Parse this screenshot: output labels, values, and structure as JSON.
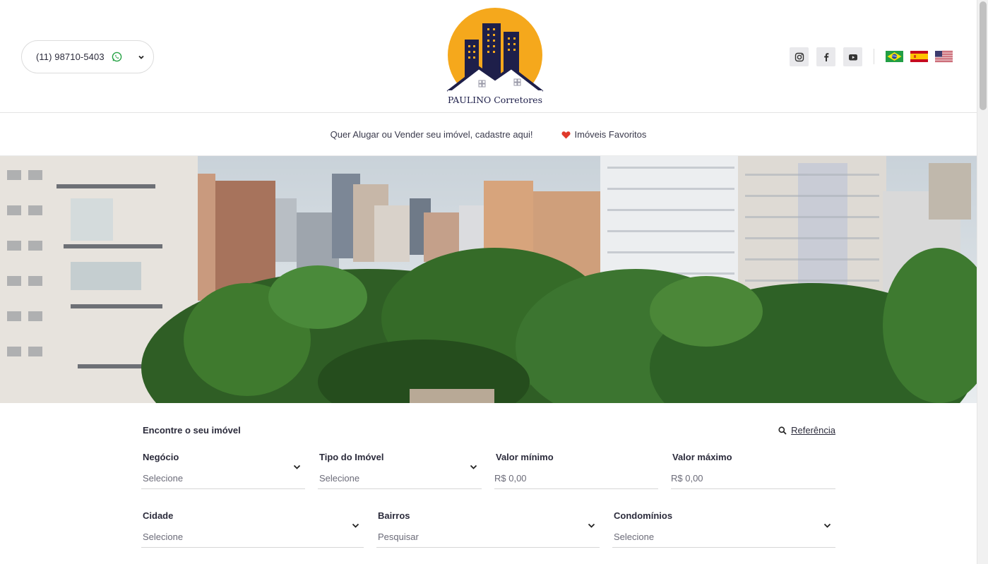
{
  "header": {
    "phone": "(11) 98710-5403",
    "logo_text": "PAULINO Corretores",
    "social": [
      "instagram-icon",
      "facebook-icon",
      "youtube-icon"
    ],
    "flags": [
      "brazil-flag",
      "spain-flag",
      "usa-flag"
    ]
  },
  "subnav": {
    "register_link": "Quer Alugar ou Vender seu imóvel, cadastre aqui!",
    "favorites_link": "Imóveis Favoritos"
  },
  "search": {
    "title": "Encontre o seu imóvel",
    "reference_link": "Referência",
    "fields": {
      "negocio": {
        "label": "Negócio",
        "value": "Selecione"
      },
      "tipo": {
        "label": "Tipo do Imóvel",
        "value": "Selecione"
      },
      "valor_min": {
        "label": "Valor mínimo",
        "placeholder": "R$ 0,00"
      },
      "valor_max": {
        "label": "Valor máximo",
        "placeholder": "R$ 0,00"
      },
      "cidade": {
        "label": "Cidade",
        "value": "Selecione"
      },
      "bairros": {
        "label": "Bairros",
        "placeholder": "Pesquisar"
      },
      "condominios": {
        "label": "Condomínios",
        "value": "Selecione"
      }
    }
  },
  "colors": {
    "brand_navy": "#1e1f4a",
    "brand_orange": "#f5a81c",
    "whatsapp": "#25a244",
    "heart": "#e0392b"
  }
}
